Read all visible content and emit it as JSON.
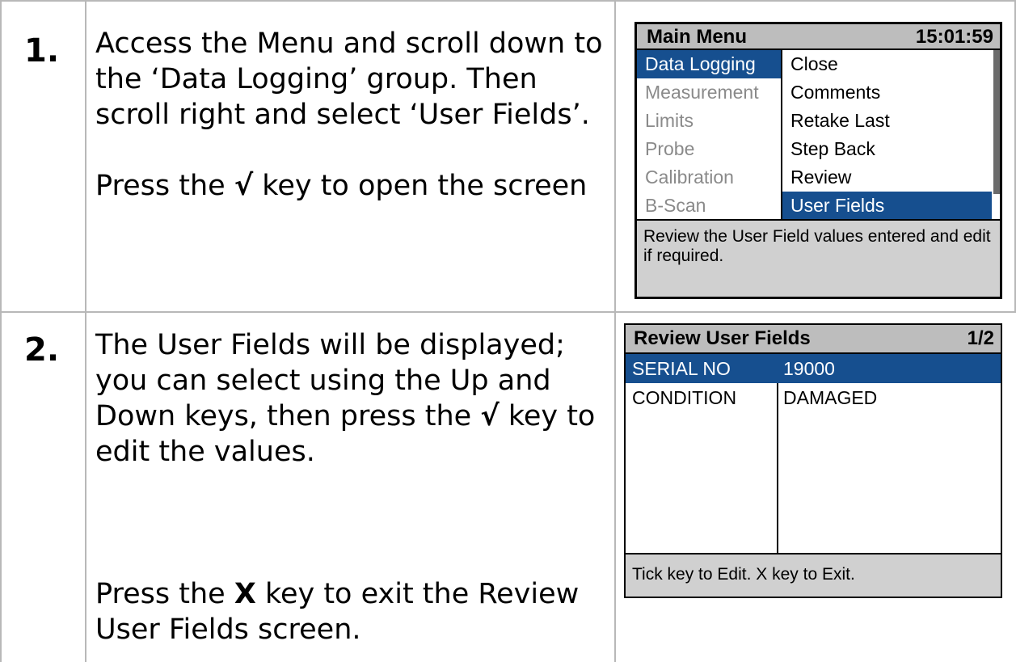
{
  "steps": [
    {
      "number": "1.",
      "text_1": "Access the Menu and scroll down to the ‘Data Logging’ group. Then scroll right and select ‘User Fields’.",
      "text_2a": "Press the ",
      "key": "√",
      "text_2b": " key to open the screen"
    },
    {
      "number": "2.",
      "text_1a": "The User Fields will be displayed; you can select using the Up and Down keys, then press the ",
      "key": "√",
      "text_1b": " key to edit the values.",
      "text_2a": "Press the ",
      "key2": "X",
      "text_2b": " key to exit the Review User Fields screen."
    }
  ],
  "main_menu": {
    "title": "Main Menu",
    "time": "15:01:59",
    "groups": [
      "Data Logging",
      "Measurement",
      "Limits",
      "Probe",
      "Calibration",
      "B-Scan"
    ],
    "items": [
      "Close",
      "Comments",
      "Retake Last",
      "Step Back",
      "Review",
      "User Fields"
    ],
    "footer": "Review the User Field values entered and edit if required."
  },
  "review_fields": {
    "title": "Review User Fields",
    "page": "1/2",
    "rows": [
      {
        "key": "SERIAL NO",
        "value": "19000"
      },
      {
        "key": "CONDITION",
        "value": "DAMAGED"
      }
    ],
    "footer": "Tick key to Edit. X key to Exit."
  }
}
